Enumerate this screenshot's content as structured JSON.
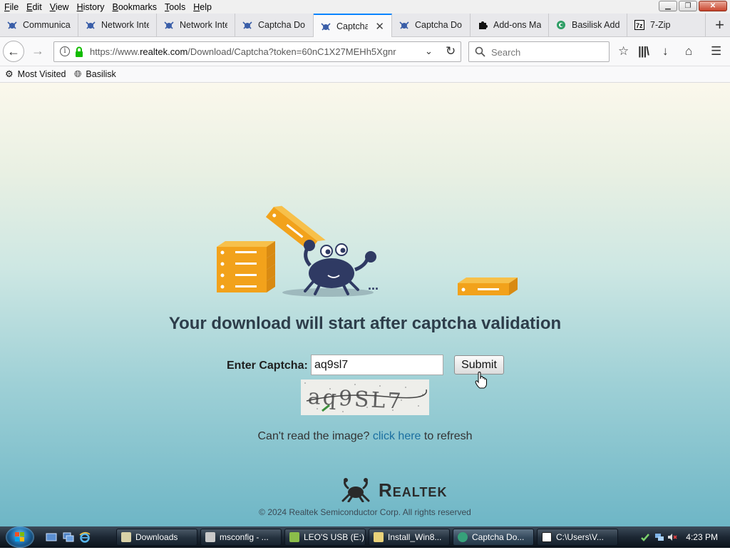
{
  "menu": [
    "File",
    "Edit",
    "View",
    "History",
    "Bookmarks",
    "Tools",
    "Help"
  ],
  "tabs": [
    {
      "label": "Communica",
      "icon": "crab-icon"
    },
    {
      "label": "Network Inte",
      "icon": "crab-icon"
    },
    {
      "label": "Network Inte",
      "icon": "crab-icon"
    },
    {
      "label": "Captcha Do",
      "icon": "crab-icon"
    },
    {
      "label": "Captcha",
      "icon": "crab-icon",
      "active": true
    },
    {
      "label": "Captcha Do",
      "icon": "crab-icon"
    },
    {
      "label": "Add-ons Ma",
      "icon": "puzzle-icon"
    },
    {
      "label": "Basilisk Add",
      "icon": "basilisk-icon"
    },
    {
      "label": "7-Zip",
      "icon": "7zip-icon"
    }
  ],
  "tab_close_glyph": "✕",
  "url": {
    "scheme": "https://www.",
    "domain": "realtek.com",
    "path": "/Download/Captcha?token=60nC1X27MEHh5Xgnr"
  },
  "search_placeholder": "Search",
  "bookmarks": [
    {
      "label": "Most Visited",
      "icon": "gear-icon"
    },
    {
      "label": "Basilisk",
      "icon": "globe-icon"
    }
  ],
  "page": {
    "heading": "Your download will start after captcha validation",
    "captcha_label": "Enter Captcha:",
    "captcha_value": "aq9sl7",
    "submit_label": "Submit",
    "captcha_image_text": "aq9SL7",
    "refresh_prefix": "Can't read the image?",
    "refresh_link": "click here",
    "refresh_suffix": "to refresh",
    "ellipsis": "...",
    "logo_text": "Realtek",
    "copyright": "© 2024 Realtek Semiconductor Corp. All rights reserved"
  },
  "taskbar": {
    "tasks": [
      {
        "label": "Downloads",
        "icon_color": "#d9d2a8"
      },
      {
        "label": "msconfig - ...",
        "icon_color": "#c9c9c9"
      },
      {
        "label": "LEO'S USB (E:)",
        "icon_color": "#8bbd4a"
      },
      {
        "label": "Install_Win8...",
        "icon_color": "#e9d27a"
      },
      {
        "label": "Captcha Do...",
        "icon_color": "#36a17a",
        "active": true
      },
      {
        "label": "C:\\Users\\V...",
        "icon_color": "#222222"
      }
    ],
    "clock": "4:23 PM"
  },
  "colors": {
    "accent_tab": "#0a84ff",
    "link": "#1a6fa0",
    "server_orange": "#f2a21b",
    "crab_navy": "#2f3a63"
  }
}
